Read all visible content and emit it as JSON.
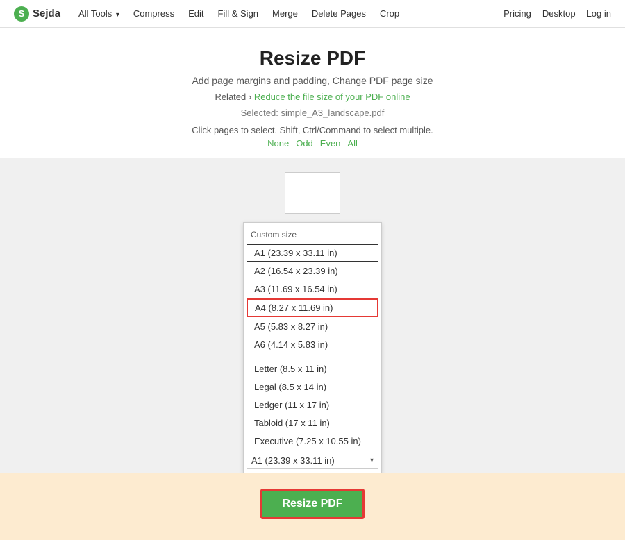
{
  "nav": {
    "logo_letter": "S",
    "logo_name": "Sejda",
    "links": [
      {
        "label": "All Tools",
        "arrow": true
      },
      {
        "label": "Compress",
        "arrow": false
      },
      {
        "label": "Edit",
        "arrow": false
      },
      {
        "label": "Fill & Sign",
        "arrow": false
      },
      {
        "label": "Merge",
        "arrow": false
      },
      {
        "label": "Delete Pages",
        "arrow": false
      },
      {
        "label": "Crop",
        "arrow": false
      }
    ],
    "right_links": [
      {
        "label": "Pricing"
      },
      {
        "label": "Desktop"
      },
      {
        "label": "Log in"
      }
    ]
  },
  "hero": {
    "title": "Resize PDF",
    "subtitle": "Add page margins and padding, Change PDF page size",
    "related_prefix": "Related",
    "related_link": "Reduce the file size of your PDF online",
    "selected_label": "Selected: simple_A3_landscape.pdf",
    "hint": "Click pages to select. Shift, Ctrl/Command to select multiple.",
    "page_links": [
      "None",
      "Odd",
      "Even",
      "All"
    ]
  },
  "dropdown": {
    "header": "Custom size",
    "items": [
      {
        "label": "A1 (23.39 x 33.11 in)",
        "style": "outline"
      },
      {
        "label": "A2 (16.54 x 23.39 in)",
        "style": "normal"
      },
      {
        "label": "A3 (11.69 x 16.54 in)",
        "style": "normal"
      },
      {
        "label": "A4 (8.27 x 11.69 in)",
        "style": "red"
      },
      {
        "label": "A5 (5.83 x 8.27 in)",
        "style": "normal"
      },
      {
        "label": "A6 (4.14 x 5.83 in)",
        "style": "normal"
      }
    ],
    "items2": [
      {
        "label": "Letter (8.5 x 11 in)",
        "style": "normal"
      },
      {
        "label": "Legal (8.5 x 14 in)",
        "style": "normal"
      },
      {
        "label": "Ledger (11 x 17 in)",
        "style": "normal"
      },
      {
        "label": "Tabloid (17 x 11 in)",
        "style": "normal"
      },
      {
        "label": "Executive (7.25 x 10.55 in)",
        "style": "normal"
      }
    ],
    "bottom_value": "A1 (23.39 x 33.11 in)"
  },
  "resize_button": "Resize PDF"
}
